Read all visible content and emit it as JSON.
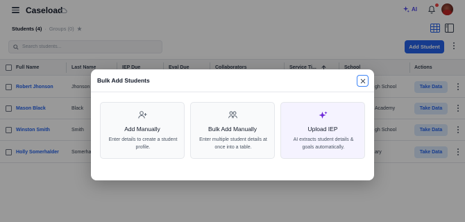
{
  "header": {
    "title": "Caseload",
    "ai_label": "AI"
  },
  "toolbar": {
    "tab_students": "Students (4)",
    "tab_separator": "·",
    "tab_groups": "Groups (0)",
    "search_placeholder": "Search students...",
    "add_student_label": "Add Student"
  },
  "table": {
    "columns": [
      "Full Name",
      "Last Name",
      "IEP Due",
      "Eval Due",
      "Collaborators",
      "Service Ti...",
      "School",
      "Actions"
    ],
    "rows": [
      {
        "full_name": "Robert Jhonson",
        "last_name": "Jhonson",
        "school": "gh School",
        "action": "Take Data"
      },
      {
        "full_name": "Mason Black",
        "last_name": "Black",
        "school": "Academy",
        "action": "Take Data"
      },
      {
        "full_name": "Winston Smith",
        "last_name": "Smith",
        "school": "gh School",
        "action": "Take Data"
      },
      {
        "full_name": "Holly Somerhalder",
        "last_name": "Somerha",
        "school": "ary",
        "action": "Take Data"
      }
    ]
  },
  "modal": {
    "title": "Bulk Add Students",
    "options": [
      {
        "title": "Add Manually",
        "description": "Enter details to create a student profile.",
        "icon": "user-plus-icon"
      },
      {
        "title": "Bulk Add Manually",
        "description": "Enter multiple student details at once into a table.",
        "icon": "users-icon"
      },
      {
        "title": "Upload IEP",
        "description": "AI extracts student details & goals automatically.",
        "icon": "sparkles-icon"
      }
    ]
  },
  "colors": {
    "primary": "#2563eb",
    "ai_accent": "#4f46e5",
    "notification": "#ef4444"
  }
}
